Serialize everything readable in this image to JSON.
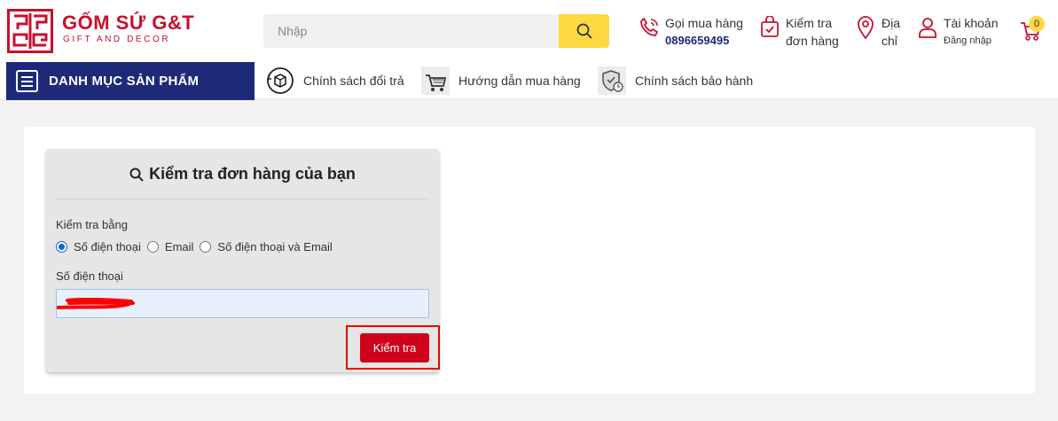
{
  "brand": {
    "name": "GỐM SỨ G&T",
    "tagline": "GIFT AND DECOR",
    "color": "#c8102e"
  },
  "search": {
    "placeholder": "Nhập",
    "button_icon": "search-icon"
  },
  "header": {
    "call": {
      "label": "Gọi mua hàng",
      "phone": "0896659495",
      "icon": "phone-icon"
    },
    "check_order": {
      "line1": "Kiểm tra",
      "line2": "đơn hàng",
      "icon": "order-box-icon"
    },
    "address": {
      "line1": "Địa",
      "line2": "chỉ",
      "icon": "map-pin-icon"
    },
    "account": {
      "label": "Tài khoản",
      "sub": "Đăng nhập",
      "icon": "user-icon"
    },
    "cart": {
      "count": "0",
      "icon": "cart-icon"
    }
  },
  "nav": {
    "category_label": "DANH MỤC SẢN PHẨM",
    "links": [
      {
        "label": "Chính sách đổi trả",
        "icon": "return-box-icon"
      },
      {
        "label": "Hướng dẫn mua hàng",
        "icon": "shopping-cart-icon"
      },
      {
        "label": "Chính sách bảo hành",
        "icon": "shield-clock-icon"
      }
    ]
  },
  "order_check": {
    "title": "Kiểm tra đơn hàng của bạn",
    "check_by_label": "Kiểm tra bằng",
    "options": [
      {
        "label": "Số điện thoại",
        "checked": true
      },
      {
        "label": "Email",
        "checked": false
      },
      {
        "label": "Số điện thoại và Email",
        "checked": false
      }
    ],
    "phone_label": "Số điện thoại",
    "phone_value": "",
    "submit_label": "Kiểm tra"
  },
  "colors": {
    "navy": "#1e2a78",
    "accent_yellow": "#fed840",
    "submit_red": "#d0021b",
    "highlight_border": "#ee0000"
  }
}
